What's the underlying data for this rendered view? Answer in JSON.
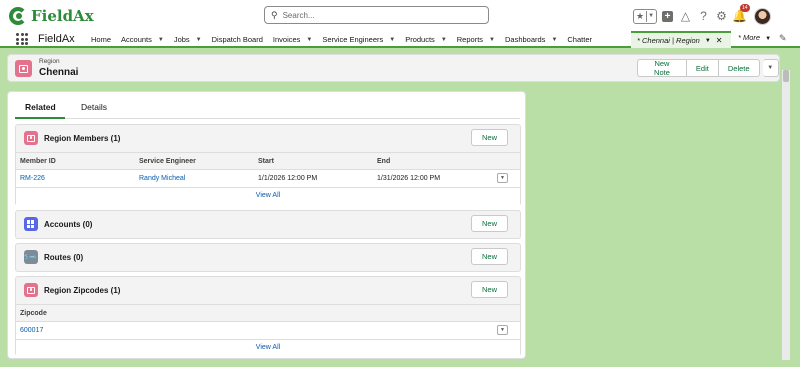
{
  "header": {
    "logo_text": "FieldAx",
    "search_placeholder": "Search...",
    "notification_count": "14"
  },
  "nav": {
    "app_name": "FieldAx",
    "items": [
      {
        "label": "Home",
        "dropdown": false
      },
      {
        "label": "Accounts",
        "dropdown": true
      },
      {
        "label": "Jobs",
        "dropdown": true
      },
      {
        "label": "Dispatch Board",
        "dropdown": false
      },
      {
        "label": "Invoices",
        "dropdown": true
      },
      {
        "label": "Service Engineers",
        "dropdown": true
      },
      {
        "label": "Products",
        "dropdown": true
      },
      {
        "label": "Reports",
        "dropdown": true
      },
      {
        "label": "Dashboards",
        "dropdown": true
      },
      {
        "label": "Chatter",
        "dropdown": false
      }
    ],
    "active_tab": "* Chennai | Region",
    "more_label": "* More"
  },
  "record": {
    "object_type": "Region",
    "name": "Chennai",
    "actions": [
      "New Note",
      "Edit",
      "Delete"
    ]
  },
  "tabs": {
    "related": "Related",
    "details": "Details"
  },
  "sections": {
    "members": {
      "title": "Region Members (1)",
      "new_label": "New",
      "columns": [
        "Member ID",
        "Service Engineer",
        "Start",
        "End"
      ],
      "rows": [
        {
          "member_id": "RM-226",
          "engineer": "Randy Micheal",
          "start": "1/1/2026 12:00 PM",
          "end": "1/31/2026 12:00 PM"
        }
      ],
      "view_all": "View All"
    },
    "accounts": {
      "title": "Accounts (0)",
      "new_label": "New"
    },
    "routes": {
      "title": "Routes (0)",
      "new_label": "New"
    },
    "zipcodes": {
      "title": "Region Zipcodes (1)",
      "new_label": "New",
      "column": "Zipcode",
      "rows": [
        {
          "zipcode": "600017"
        }
      ],
      "view_all": "View All"
    }
  },
  "colors": {
    "brand_green": "#2e8b3a",
    "background": "#b9dfa6",
    "link_blue": "#0b5cab",
    "region_icon": "#e3738d",
    "accounts_icon": "#5867e8",
    "routes_icon": "#7e8c99"
  }
}
